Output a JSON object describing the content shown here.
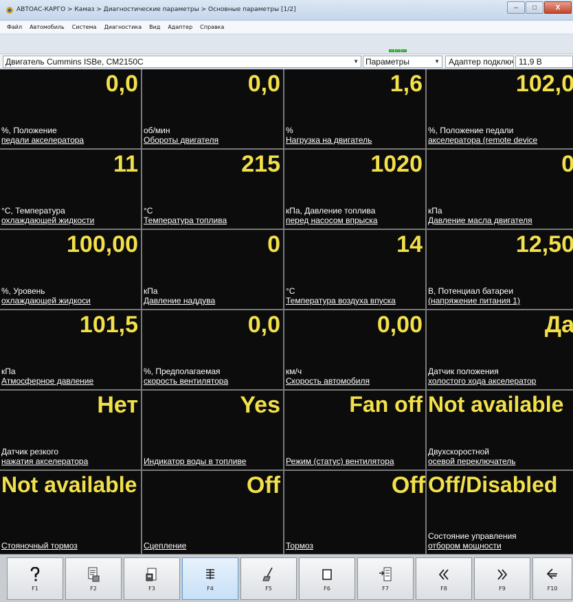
{
  "window": {
    "title": "АВТОАС-КАРГО > Камаз > Диагностические параметры > Основные параметры [1/2]",
    "min_label": "–",
    "max_label": "□",
    "close_label": "X"
  },
  "menu": [
    "Файл",
    "Автомобиль",
    "Система",
    "Диагностика",
    "Вид",
    "Адаптер",
    "Справка"
  ],
  "selector": {
    "engine": "Двигатель Cummins ISBe, CM2150C",
    "mode": "Параметры",
    "adapter_status": "Адаптер подключен",
    "voltage": "11,9 В"
  },
  "colors": {
    "value": "#f2e04a",
    "label": "#ffffff",
    "cell_bg": "#0c0c0c"
  },
  "params": [
    {
      "value": "0,0",
      "label1": "%, Положение",
      "label2": "педали акселератора"
    },
    {
      "value": "0,0",
      "label1": "об/мин",
      "label2": "Обороты двигателя"
    },
    {
      "value": "1,6",
      "label1": "%",
      "label2": "Нагрузка на двигатель"
    },
    {
      "value": "102,0",
      "label1": "%, Положение педали",
      "label2": "акселератора (remote device"
    },
    {
      "value": "11",
      "label1": "°С, Температура",
      "label2": "охлаждающей жидкости"
    },
    {
      "value": "215",
      "label1": "°С",
      "label2": "Температура топлива"
    },
    {
      "value": "1020",
      "label1": "кПа, Давление топлива",
      "label2": "перед насосом впрыска"
    },
    {
      "value": "0",
      "label1": "кПа",
      "label2": "Давление масла двигателя"
    },
    {
      "value": "100,00",
      "label1": "%, Уровень",
      "label2": "охлаждающей жидкоси"
    },
    {
      "value": "0",
      "label1": "кПа",
      "label2": "Давление наддува"
    },
    {
      "value": "14",
      "label1": "°С",
      "label2": "Температура воздуха впуска"
    },
    {
      "value": "12,50",
      "label1": "В, Потенциал батареи",
      "label2": "(напряжение питания 1)"
    },
    {
      "value": "101,5",
      "label1": "кПа",
      "label2": "Атмосферное давление"
    },
    {
      "value": "0,0",
      "label1": "%, Предполагаемая",
      "label2": "скорость вентилятора"
    },
    {
      "value": "0,00",
      "label1": "км/ч",
      "label2": "Скорость автомобиля"
    },
    {
      "value": "Да",
      "label1": "Датчик положения",
      "label2": "холостого хода акселератор"
    },
    {
      "value": "Нет",
      "label1": "Датчик резкого",
      "label2": "нажатия акселератора"
    },
    {
      "value": "Yes",
      "label1": "",
      "label2": "Индикатор воды в топливе"
    },
    {
      "value": "Fan off",
      "label1": "",
      "label2": "Режим (статус) вентилятора"
    },
    {
      "value": "Not available",
      "label1": "Двухскоростной",
      "label2": "осевой переключатель"
    },
    {
      "value": "Not available",
      "label1": "",
      "label2": "Стояночный тормоз"
    },
    {
      "value": "Off",
      "label1": "",
      "label2": "Сцепление"
    },
    {
      "value": "Off",
      "label1": "",
      "label2": "Тормоз"
    },
    {
      "value": "Off/Disabled",
      "label1": "Состояние управления",
      "label2": "отбором мощности"
    }
  ],
  "fkeys": [
    {
      "name": "F1",
      "icon": "help-icon"
    },
    {
      "name": "F2",
      "icon": "report-icon"
    },
    {
      "name": "F3",
      "icon": "save-icon"
    },
    {
      "name": "F4",
      "icon": "list-icon"
    },
    {
      "name": "F5",
      "icon": "clear-icon"
    },
    {
      "name": "F6",
      "icon": "window-icon"
    },
    {
      "name": "F7",
      "icon": "record-icon"
    },
    {
      "name": "F8",
      "icon": "prev-page-icon"
    },
    {
      "name": "F9",
      "icon": "next-page-icon"
    },
    {
      "name": "F10",
      "icon": "exit-icon"
    }
  ]
}
